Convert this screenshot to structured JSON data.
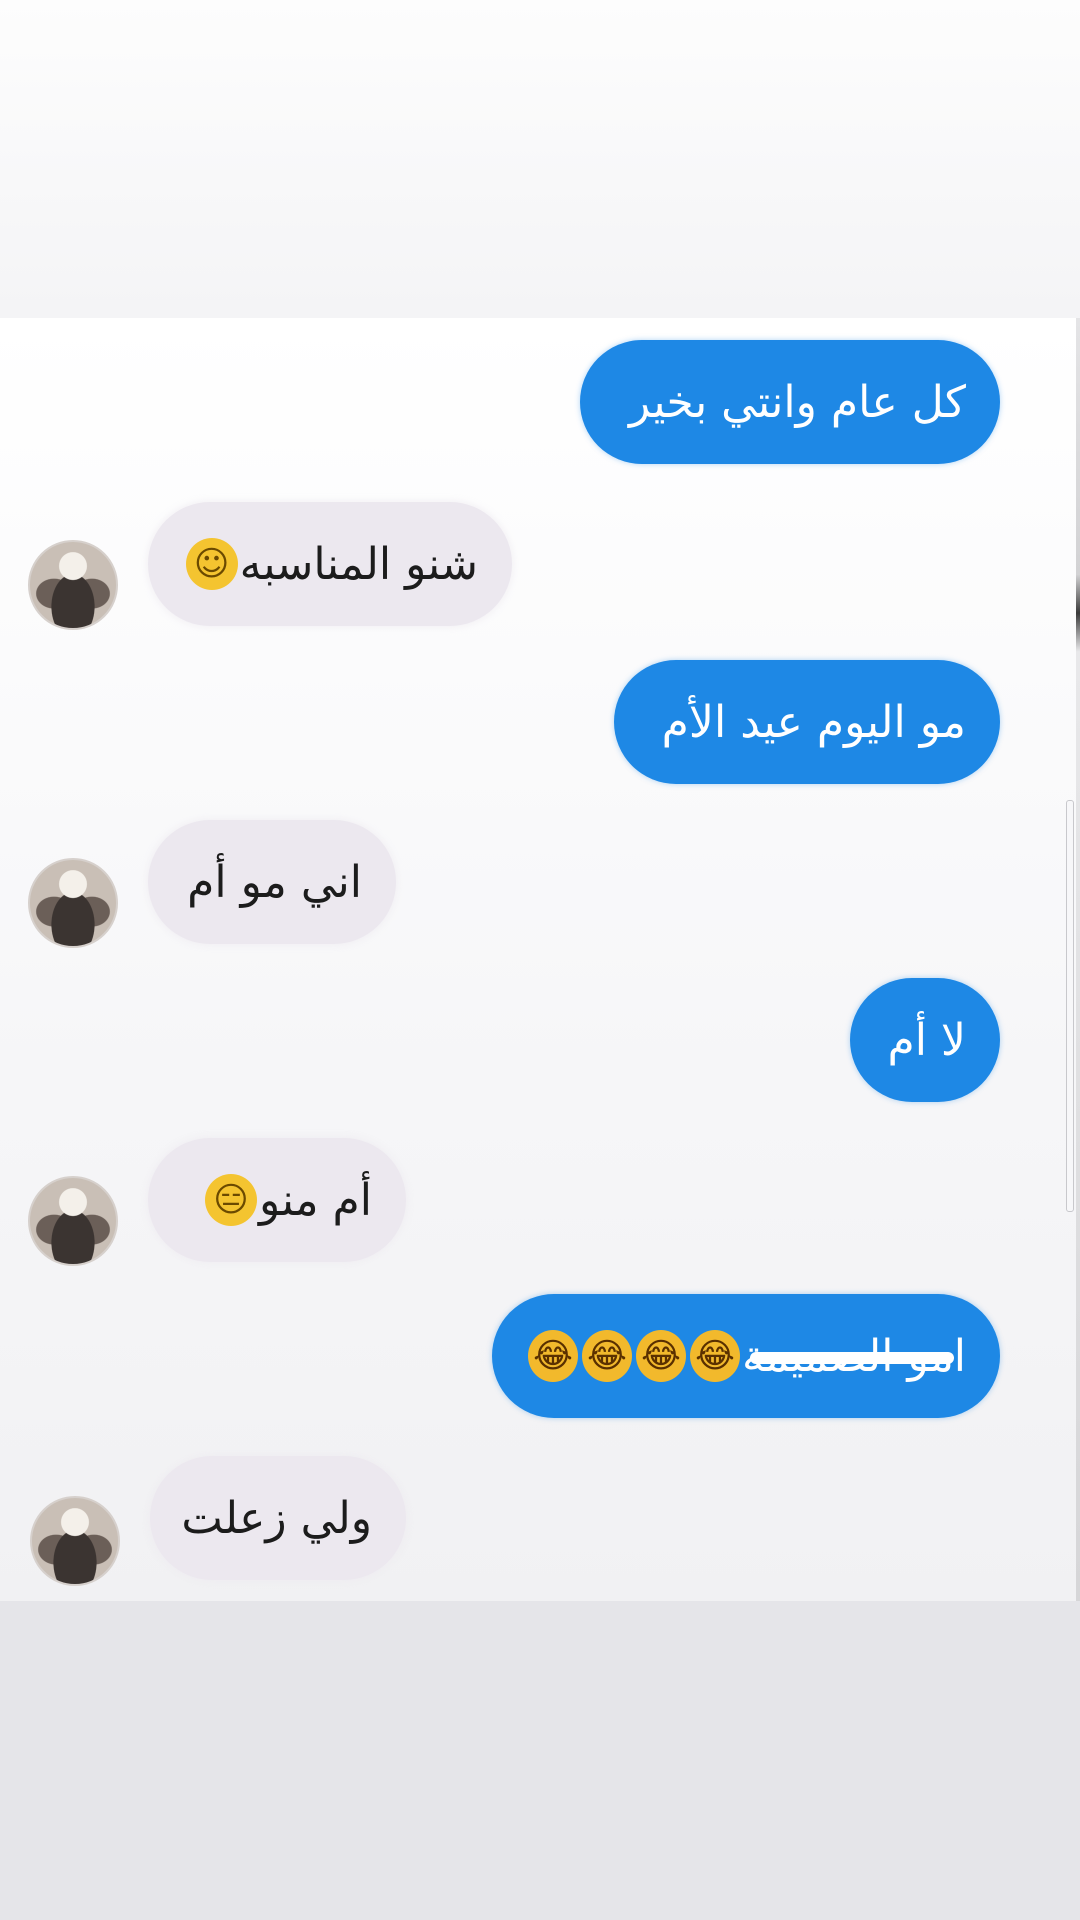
{
  "messages": [
    {
      "side": "sent",
      "text": "كل عام وانتي بخير"
    },
    {
      "side": "received",
      "text": "شنو المناسبه",
      "emoji": "slight-smile-emoji"
    },
    {
      "side": "sent",
      "text": "مو اليوم عيد الأم"
    },
    {
      "side": "received",
      "text": "اني مو أم"
    },
    {
      "side": "sent",
      "text": "لا أم"
    },
    {
      "side": "received",
      "text": "أم منو",
      "emoji": "expressionless-emoji"
    },
    {
      "side": "sent",
      "text": "امو الصميمة",
      "emoji": "laughing-emoji",
      "emoji_count": 4,
      "text_struck_out": true
    },
    {
      "side": "received",
      "text": "ولي زعلت"
    }
  ],
  "colors": {
    "sent_bubble": "#1e88e5",
    "received_bubble": "#ece8ef",
    "sent_text": "#ffffff",
    "received_text": "#1c1c1c"
  },
  "icons": {
    "avatar": "contact-avatar"
  }
}
